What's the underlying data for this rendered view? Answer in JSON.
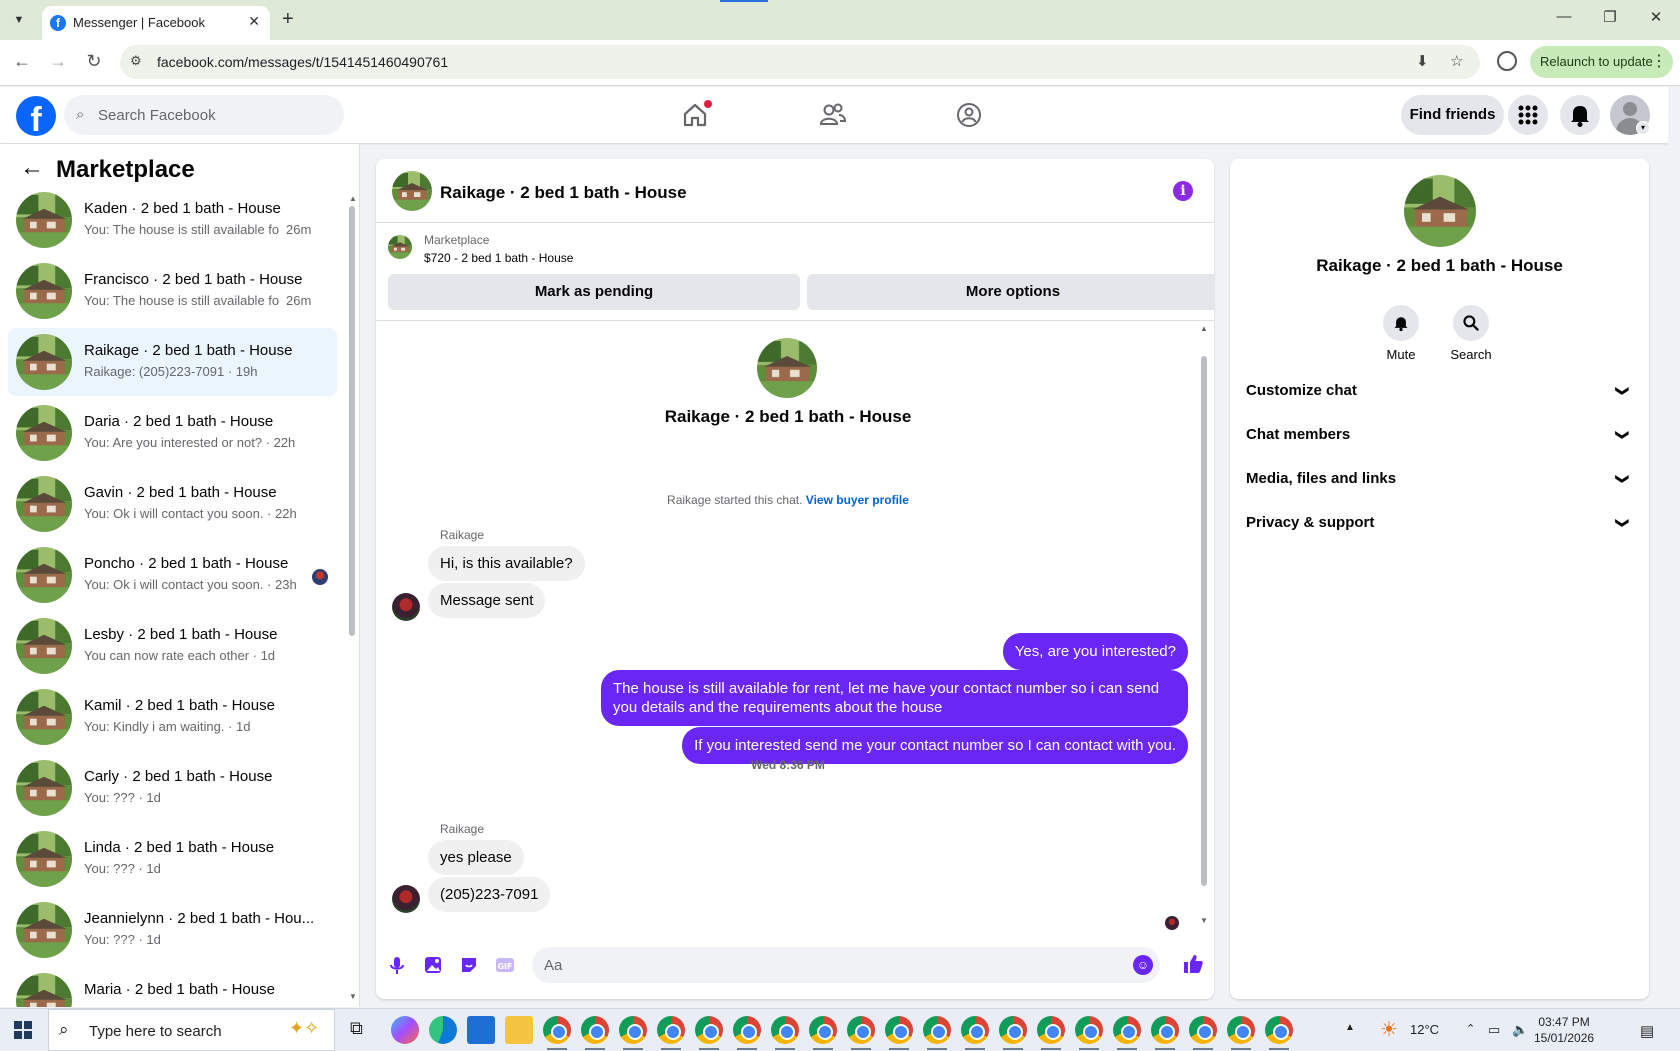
{
  "browser": {
    "tab_title": "Messenger | Facebook",
    "url": "facebook.com/messages/t/1541451460490761",
    "relaunch_label": "Relaunch to update"
  },
  "header": {
    "search_placeholder": "Search Facebook",
    "find_friends_label": "Find friends"
  },
  "left_panel": {
    "title": "Marketplace",
    "conversations": [
      {
        "name": "Kaden · 2 bed 1 bath - House",
        "snippet": "You: The house is still available fo...",
        "time": "26m"
      },
      {
        "name": "Francisco · 2 bed 1 bath - House",
        "snippet": "You: The house is still available fo...",
        "time": "26m"
      },
      {
        "name": "Raikage · 2 bed 1 bath - House",
        "snippet": "Raikage: (205)223-7091 · 19h",
        "time": ""
      },
      {
        "name": "Daria · 2 bed 1 bath - House",
        "snippet": "You: Are you interested or not? · 22h",
        "time": ""
      },
      {
        "name": "Gavin · 2 bed 1 bath - House",
        "snippet": "You: Ok i will contact you soon. · 22h",
        "time": ""
      },
      {
        "name": "Poncho · 2 bed 1 bath - House",
        "snippet": "You: Ok i will contact you soon. · 23h",
        "time": ""
      },
      {
        "name": "Lesby · 2 bed 1 bath - House",
        "snippet": "You can now rate each other · 1d",
        "time": ""
      },
      {
        "name": "Kamil · 2 bed 1 bath - House",
        "snippet": "You: Kindly i am waiting. · 1d",
        "time": ""
      },
      {
        "name": "Carly · 2 bed 1 bath - House",
        "snippet": "You: ??? · 1d",
        "time": ""
      },
      {
        "name": "Linda · 2 bed 1 bath - House",
        "snippet": "You: ??? · 1d",
        "time": ""
      },
      {
        "name": "Jeannielynn · 2 bed 1 bath - Hou...",
        "snippet": "You: ??? · 1d",
        "time": ""
      },
      {
        "name": "Maria · 2 bed 1 bath - House",
        "snippet": "",
        "time": ""
      }
    ]
  },
  "chat": {
    "title": "Raikage · 2 bed 1 bath - House",
    "listing_label": "Marketplace",
    "listing_price": "$720 - 2 bed 1 bath - House",
    "mark_pending_label": "Mark as pending",
    "more_options_label": "More options",
    "intro_title": "Raikage · 2 bed 1 bath - House",
    "started_text": "Raikage started this chat.",
    "view_buyer_profile": "View buyer profile",
    "sender_name": "Raikage",
    "incoming_1": "Hi, is this available?",
    "incoming_2": "Message sent",
    "outgoing_1": "Yes, are you interested?",
    "outgoing_2": "The house is still available for rent, let me have your contact number so i can send you details and the requirements about the house",
    "outgoing_3": "If you interested send me your contact number so I can contact with you.",
    "timestamp": "Wed 8:36 PM",
    "incoming_3": "yes please",
    "incoming_4": "(205)223-7091",
    "composer_placeholder": "Aa"
  },
  "right_panel": {
    "title": "Raikage · 2 bed 1 bath - House",
    "mute_label": "Mute",
    "search_label": "Search",
    "sections": [
      "Customize chat",
      "Chat members",
      "Media, files and links",
      "Privacy & support"
    ]
  },
  "taskbar": {
    "search_text": "Type here to search",
    "weather": "12°C",
    "time": "03:47 PM",
    "date": "15/01/2026"
  },
  "colors": {
    "facebook_blue": "#0866ff",
    "messenger_purple": "#6a26f5",
    "active_row": "#ebf5ff"
  }
}
